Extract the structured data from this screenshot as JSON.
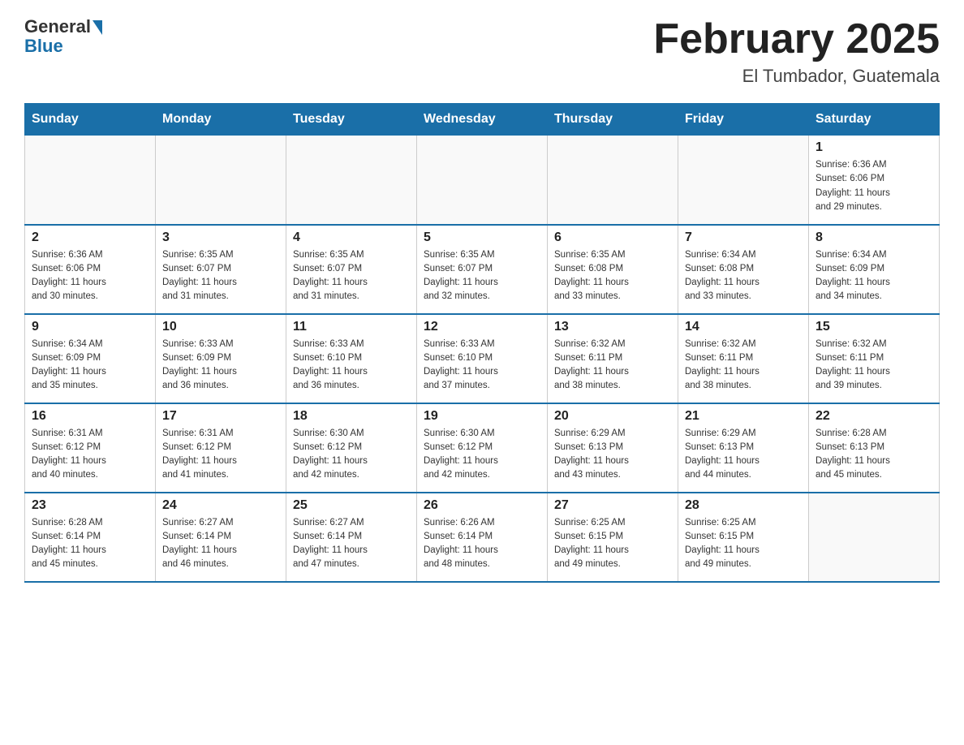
{
  "logo": {
    "general": "General",
    "blue": "Blue"
  },
  "title": "February 2025",
  "location": "El Tumbador, Guatemala",
  "days_of_week": [
    "Sunday",
    "Monday",
    "Tuesday",
    "Wednesday",
    "Thursday",
    "Friday",
    "Saturday"
  ],
  "weeks": [
    [
      {
        "day": "",
        "info": ""
      },
      {
        "day": "",
        "info": ""
      },
      {
        "day": "",
        "info": ""
      },
      {
        "day": "",
        "info": ""
      },
      {
        "day": "",
        "info": ""
      },
      {
        "day": "",
        "info": ""
      },
      {
        "day": "1",
        "info": "Sunrise: 6:36 AM\nSunset: 6:06 PM\nDaylight: 11 hours\nand 29 minutes."
      }
    ],
    [
      {
        "day": "2",
        "info": "Sunrise: 6:36 AM\nSunset: 6:06 PM\nDaylight: 11 hours\nand 30 minutes."
      },
      {
        "day": "3",
        "info": "Sunrise: 6:35 AM\nSunset: 6:07 PM\nDaylight: 11 hours\nand 31 minutes."
      },
      {
        "day": "4",
        "info": "Sunrise: 6:35 AM\nSunset: 6:07 PM\nDaylight: 11 hours\nand 31 minutes."
      },
      {
        "day": "5",
        "info": "Sunrise: 6:35 AM\nSunset: 6:07 PM\nDaylight: 11 hours\nand 32 minutes."
      },
      {
        "day": "6",
        "info": "Sunrise: 6:35 AM\nSunset: 6:08 PM\nDaylight: 11 hours\nand 33 minutes."
      },
      {
        "day": "7",
        "info": "Sunrise: 6:34 AM\nSunset: 6:08 PM\nDaylight: 11 hours\nand 33 minutes."
      },
      {
        "day": "8",
        "info": "Sunrise: 6:34 AM\nSunset: 6:09 PM\nDaylight: 11 hours\nand 34 minutes."
      }
    ],
    [
      {
        "day": "9",
        "info": "Sunrise: 6:34 AM\nSunset: 6:09 PM\nDaylight: 11 hours\nand 35 minutes."
      },
      {
        "day": "10",
        "info": "Sunrise: 6:33 AM\nSunset: 6:09 PM\nDaylight: 11 hours\nand 36 minutes."
      },
      {
        "day": "11",
        "info": "Sunrise: 6:33 AM\nSunset: 6:10 PM\nDaylight: 11 hours\nand 36 minutes."
      },
      {
        "day": "12",
        "info": "Sunrise: 6:33 AM\nSunset: 6:10 PM\nDaylight: 11 hours\nand 37 minutes."
      },
      {
        "day": "13",
        "info": "Sunrise: 6:32 AM\nSunset: 6:11 PM\nDaylight: 11 hours\nand 38 minutes."
      },
      {
        "day": "14",
        "info": "Sunrise: 6:32 AM\nSunset: 6:11 PM\nDaylight: 11 hours\nand 38 minutes."
      },
      {
        "day": "15",
        "info": "Sunrise: 6:32 AM\nSunset: 6:11 PM\nDaylight: 11 hours\nand 39 minutes."
      }
    ],
    [
      {
        "day": "16",
        "info": "Sunrise: 6:31 AM\nSunset: 6:12 PM\nDaylight: 11 hours\nand 40 minutes."
      },
      {
        "day": "17",
        "info": "Sunrise: 6:31 AM\nSunset: 6:12 PM\nDaylight: 11 hours\nand 41 minutes."
      },
      {
        "day": "18",
        "info": "Sunrise: 6:30 AM\nSunset: 6:12 PM\nDaylight: 11 hours\nand 42 minutes."
      },
      {
        "day": "19",
        "info": "Sunrise: 6:30 AM\nSunset: 6:12 PM\nDaylight: 11 hours\nand 42 minutes."
      },
      {
        "day": "20",
        "info": "Sunrise: 6:29 AM\nSunset: 6:13 PM\nDaylight: 11 hours\nand 43 minutes."
      },
      {
        "day": "21",
        "info": "Sunrise: 6:29 AM\nSunset: 6:13 PM\nDaylight: 11 hours\nand 44 minutes."
      },
      {
        "day": "22",
        "info": "Sunrise: 6:28 AM\nSunset: 6:13 PM\nDaylight: 11 hours\nand 45 minutes."
      }
    ],
    [
      {
        "day": "23",
        "info": "Sunrise: 6:28 AM\nSunset: 6:14 PM\nDaylight: 11 hours\nand 45 minutes."
      },
      {
        "day": "24",
        "info": "Sunrise: 6:27 AM\nSunset: 6:14 PM\nDaylight: 11 hours\nand 46 minutes."
      },
      {
        "day": "25",
        "info": "Sunrise: 6:27 AM\nSunset: 6:14 PM\nDaylight: 11 hours\nand 47 minutes."
      },
      {
        "day": "26",
        "info": "Sunrise: 6:26 AM\nSunset: 6:14 PM\nDaylight: 11 hours\nand 48 minutes."
      },
      {
        "day": "27",
        "info": "Sunrise: 6:25 AM\nSunset: 6:15 PM\nDaylight: 11 hours\nand 49 minutes."
      },
      {
        "day": "28",
        "info": "Sunrise: 6:25 AM\nSunset: 6:15 PM\nDaylight: 11 hours\nand 49 minutes."
      },
      {
        "day": "",
        "info": ""
      }
    ]
  ]
}
